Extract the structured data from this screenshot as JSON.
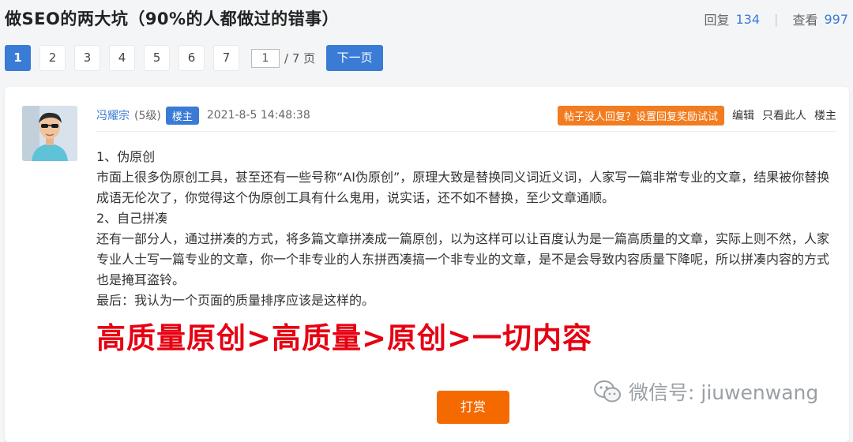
{
  "thread": {
    "title": "做SEO的两大坑（90%的人都做过的错事）",
    "reply_label": "回复",
    "reply_count": "134",
    "view_label": "查看",
    "view_count": "997"
  },
  "pager": {
    "pages": [
      "1",
      "2",
      "3",
      "4",
      "5",
      "6",
      "7"
    ],
    "active_page": "1",
    "jump_value": "1",
    "total_label": "/ 7 页",
    "next_label": "下一页"
  },
  "post": {
    "author": "冯耀宗",
    "level": "(5级)",
    "owner_badge": "楼主",
    "time": "2021-8-5 14:48:38",
    "promo": "帖子没人回复？设置回复奖励试试",
    "edit": "编辑",
    "only_author": "只看此人",
    "floor": "楼主",
    "lines": [
      "1、伪原创",
      "市面上很多伪原创工具，甚至还有一些号称“AI伪原创”，原理大致是替换同义词近义词，人家写一篇非常专业的文章，结果被你替换成语无伦次了，你觉得这个伪原创工具有什么鬼用，说实话，还不如不替换，至少文章通顺。",
      "2、自己拼凑",
      "还有一部分人，通过拼凑的方式，将多篇文章拼凑成一篇原创，以为这样可以让百度认为是一篇高质量的文章，实际上则不然，人家专业人士写一篇专业的文章，你一个非专业的人东拼西凑搞一个非专业的文章，是不是会导致内容质量下降呢，所以拼凑内容的方式也是掩耳盗铃。",
      "最后：我认为一个页面的质量排序应该是这样的。"
    ],
    "highlight": "高质量原创>高质量>原创>一切内容",
    "reward_label": "打赏"
  },
  "watermark": {
    "icon": "wechat-icon",
    "text": "微信号: jiuwenwang"
  },
  "colors": {
    "accent": "#3a7bd5",
    "promo": "#f27c1f",
    "reward": "#f56a00",
    "highlight": "#e60012"
  }
}
